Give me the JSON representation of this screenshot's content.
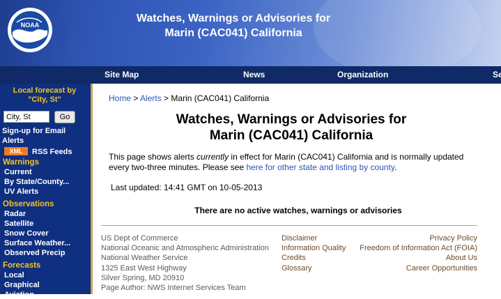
{
  "header": {
    "title_line1": "Watches, Warnings or Advisories for",
    "title_line2": "Marin (CAC041) California",
    "logo_text": "NOAA"
  },
  "nav": {
    "items": [
      "Site Map",
      "News",
      "Organization"
    ],
    "cut_label": "Se"
  },
  "sidebar": {
    "local_title_1": "Local forecast by",
    "local_title_2": "\"City, St\"",
    "city_input_value": "City, St",
    "go_label": "Go",
    "signup_1": "Sign-up for Email",
    "signup_2": "Alerts",
    "xml_badge": "XML",
    "rss_label": "RSS Feeds",
    "warnings_head": "Warnings",
    "warnings": [
      "Current",
      "By State/County...",
      "UV Alerts"
    ],
    "observations_head": "Observations",
    "observations": [
      "Radar",
      "Satellite",
      "Snow Cover",
      "Surface Weather...",
      "Observed Precip"
    ],
    "forecasts_head": "Forecasts",
    "forecasts": [
      "Local",
      "Graphical",
      "Aviation"
    ]
  },
  "breadcrumb": {
    "home": "Home",
    "sep": " > ",
    "alerts": "Alerts",
    "current": "Marin (CAC041) California"
  },
  "main": {
    "title_line1": "Watches, Warnings or Advisories for",
    "title_line2": "Marin (CAC041) California",
    "intro_a": "This page shows alerts ",
    "intro_em": "currently",
    "intro_b": " in effect for Marin (CAC041) California and is normally updated every two-three minutes. Please see ",
    "intro_link": "here for other state and listing by county",
    "intro_c": ".",
    "last_updated": "Last updated: 14:41 GMT on 10-05-2013",
    "no_alerts": "There are no active watches, warnings or advisories"
  },
  "footer": {
    "left": [
      "US Dept of Commerce",
      "National Oceanic and Atmospheric Administration",
      "National Weather Service",
      "1325 East West Highway",
      "Silver Spring, MD 20910",
      "Page Author: NWS Internet Services Team"
    ],
    "middle": [
      "Disclaimer",
      "Information Quality",
      "Credits",
      "Glossary"
    ],
    "right": [
      "Privacy Policy",
      "Freedom of Information Act (FOIA)",
      "About Us",
      "Career Opportunities"
    ]
  }
}
